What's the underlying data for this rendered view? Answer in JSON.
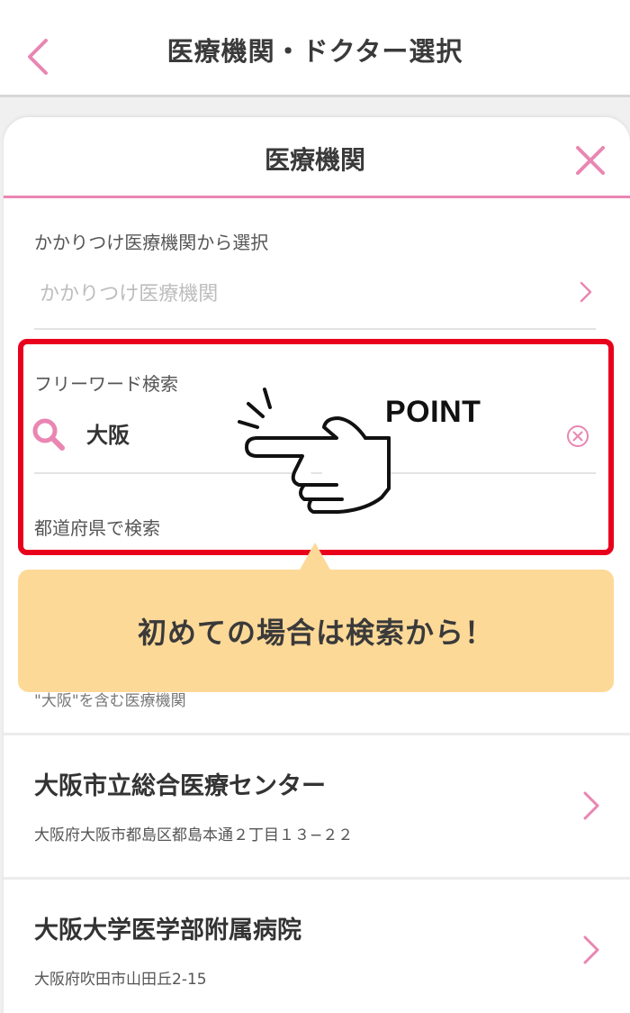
{
  "header": {
    "title": "医療機関・ドクター選択",
    "back_icon": "chevron-left-icon"
  },
  "sheet": {
    "title": "医療機関",
    "close_icon": "close-x-icon"
  },
  "favorite_section": {
    "label": "かかりつけ医療機関から選択",
    "placeholder": "かかりつけ医療機関"
  },
  "freeword_section": {
    "label": "フリーワード検索",
    "value": "大阪",
    "search_icon": "search-icon",
    "clear_icon": "clear-circle-icon"
  },
  "prefecture_section": {
    "label": "都道府県で検索"
  },
  "results_caption": "\"大阪\"を含む医療機関",
  "results": [
    {
      "name": "大阪市立総合医療センター",
      "address": "大阪府大阪市都島区都島本通２丁目１３−２２"
    },
    {
      "name": "大阪大学医学部附属病院",
      "address": "大阪府吹田市山田丘2-15"
    }
  ],
  "annotation": {
    "point_label": "POINT",
    "callout_text": "初めての場合は検索から！",
    "hand_icon": "pointing-hand-icon"
  },
  "colors": {
    "accent_pink": "#e986b2",
    "highlight_red": "#e8001d",
    "callout_bg": "#fdd998"
  }
}
